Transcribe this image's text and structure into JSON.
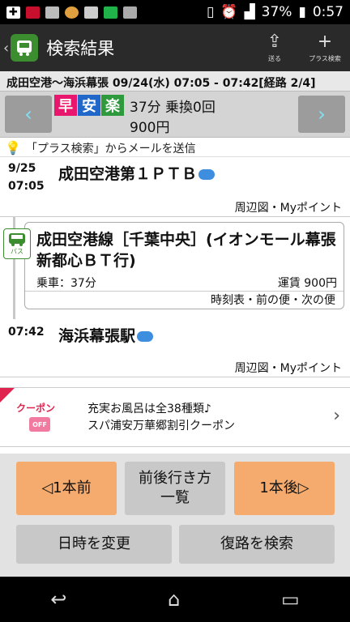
{
  "status_bar": {
    "battery": "37%",
    "time": "0:57"
  },
  "app_bar": {
    "title": "検索結果",
    "send_label": "送る",
    "plus_label": "プラス検索"
  },
  "route": {
    "header": "成田空港～海浜幕張 09/24(水) 07:05 - 07:42[経路 2/4]",
    "badges": [
      "早",
      "安",
      "楽"
    ],
    "badge_colors": [
      "#e8176d",
      "#1f67c8",
      "#2e9a3d"
    ],
    "duration_transfers": "37分 乗換0回",
    "fare": "900円"
  },
  "mail_link": "「プラス検索」からメールを送信",
  "departure": {
    "date": "9/25",
    "time": "07:05",
    "station": "成田空港第１ＰＴＢ",
    "links": "周辺図・Myポイント"
  },
  "segment": {
    "icon_label": "バス",
    "line": "成田空港線［千葉中央］(イオンモール幕張新都心ＢＴ行)",
    "ride": "乗車：37分",
    "fare": "運賃 900円",
    "links": "時刻表・前の便・次の便"
  },
  "arrival": {
    "time": "07:42",
    "station": "海浜幕張駅",
    "links": "周辺図・Myポイント"
  },
  "coupon": {
    "label": "クーポン",
    "off": "OFF",
    "line1": "充実お風呂は全38種類♪",
    "line2": "スパ浦安万華郷割引クーポン"
  },
  "buttons": {
    "prev": "◁1本前",
    "list": "前後行き方一覧",
    "next": "1本後▷",
    "change_datetime": "日時を変更",
    "return_route": "復路を検索"
  }
}
